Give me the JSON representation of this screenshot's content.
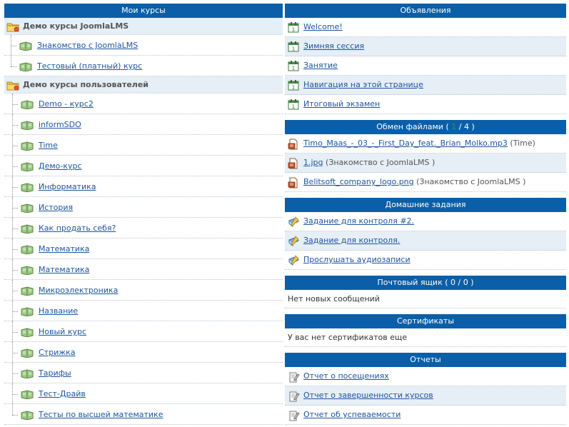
{
  "left": {
    "header": "Мои курсы",
    "categories": [
      {
        "title": "Демо курсы JoomlaLMS",
        "courses": [
          "Знакомство с JoomlaLMS",
          "Тестовый (платный) курс"
        ]
      },
      {
        "title": "Демо курсы пользователей",
        "courses": [
          "Demo - курс2",
          "informSDO",
          "Time",
          "Демо-курс",
          "Информатика",
          "История",
          "Как продать себя?",
          "Математика",
          "Математика",
          "Микроэлектроника",
          "Название",
          "Новый курс",
          "Стрижка",
          "Тарифы",
          "Тест-Драйв",
          "Тесты по высшей математике"
        ]
      }
    ]
  },
  "right": {
    "announcements": {
      "header": "Объявления",
      "items": [
        "Welcome!",
        "Зимняя сессия",
        "Занятие",
        "Навигация на этой странице",
        "Итоговый экзамен"
      ]
    },
    "files": {
      "header_prefix": "Обмен файлами ( ",
      "header_new": "1",
      "header_suffix": " / 4 )",
      "items": [
        {
          "name": "Timo_Maas_-_03_-_First_Day_feat._Brian_Molko.mp3",
          "course": " (Time)"
        },
        {
          "name": "1.jpg",
          "course": " (Знакомство с JoomlaLMS )"
        },
        {
          "name": "Belitsoft_company_logo.png",
          "course": " (Знакомство с JoomlaLMS )"
        }
      ]
    },
    "homework": {
      "header": "Домашние задания",
      "items": [
        "Задание для контроля #2.",
        "Задание для контроля.",
        "Прослушать аудиозаписи"
      ]
    },
    "mailbox": {
      "header": "Почтовый ящик ( 0 / 0 )",
      "text": "Нет новых сообщений"
    },
    "certificates": {
      "header": "Сертификаты",
      "text": "У вас нет сертификатов еще"
    },
    "reports": {
      "header": "Отчеты",
      "items": [
        "Отчет о посещениях",
        "Отчет о завершенности курсов",
        "Отчет об успеваемости"
      ]
    }
  },
  "colors": {
    "header_bg": "#0b5fa8",
    "link": "#1d55a0",
    "alt_row": "#e6eef6",
    "folder": "#f0c040",
    "course_icon": "#86b56e"
  }
}
